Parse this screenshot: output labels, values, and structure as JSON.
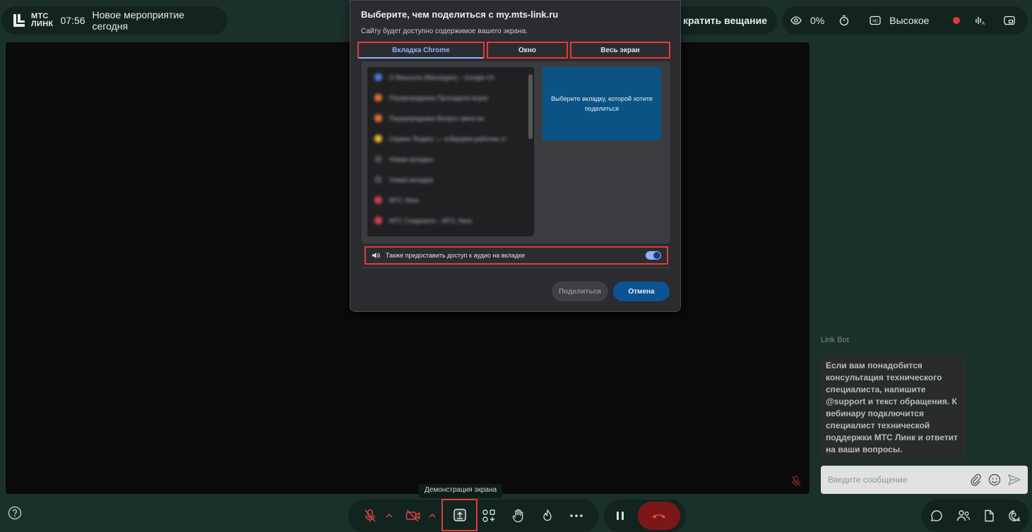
{
  "header": {
    "logo_line1": "МТС",
    "logo_line2": "ЛИНК",
    "time": "07:56",
    "event_title": "Новое мероприятие сегодня",
    "stop_broadcast": "кратить вещание",
    "view_percent": "0%",
    "quality": "Высокое"
  },
  "dialog": {
    "title": "Выберите, чем поделиться с my.mts-link.ru",
    "subtitle": "Сайту будет доступно содержимое вашего экрана.",
    "tabs": [
      "Вкладка Chrome",
      "Окно",
      "Весь экран"
    ],
    "tab_list": [
      {
        "text": "О Вишнуте (Маскедон) – Google Ch",
        "color": "#4a7bd6"
      },
      {
        "text": "Перерпредника Проходила внукн",
        "color": "#e0722c"
      },
      {
        "text": "Перерпредника Вопрос меня вн",
        "color": "#e0722c"
      },
      {
        "text": "Сервис Яндекс — отбираем рабочие ст",
        "color": "#e8b92a"
      },
      {
        "text": "Новая вкладка",
        "color": "#4a4c50"
      },
      {
        "text": "Новая вкладка",
        "color": "#4a4c50"
      },
      {
        "text": "МТС Линк",
        "color": "#d64050"
      },
      {
        "text": "МТС Снидомли – МТС Линк",
        "color": "#d64050"
      }
    ],
    "preview_text": "Выберите вкладку, которой хотите поделиться",
    "audio_label": "Также предоставить доступ к аудио на вкладке",
    "share_label": "Поделиться",
    "cancel_label": "Отмена"
  },
  "chat": {
    "bot_name": "Link Bot",
    "message": "Если вам понадобится консультация технического специалиста, напишите @support и текст обращения. К вебинару подключится специалист технической поддержки МТС Линк и ответит на ваши вопросы.",
    "input_placeholder": "Введите сообщение"
  },
  "toolbar": {
    "tooltip": "Демонстрация экрана"
  },
  "colors": {
    "background": "#1c302b",
    "accent_blue": "#0b5394",
    "highlight_red": "#e53b3b",
    "hangup": "#7b1717"
  }
}
